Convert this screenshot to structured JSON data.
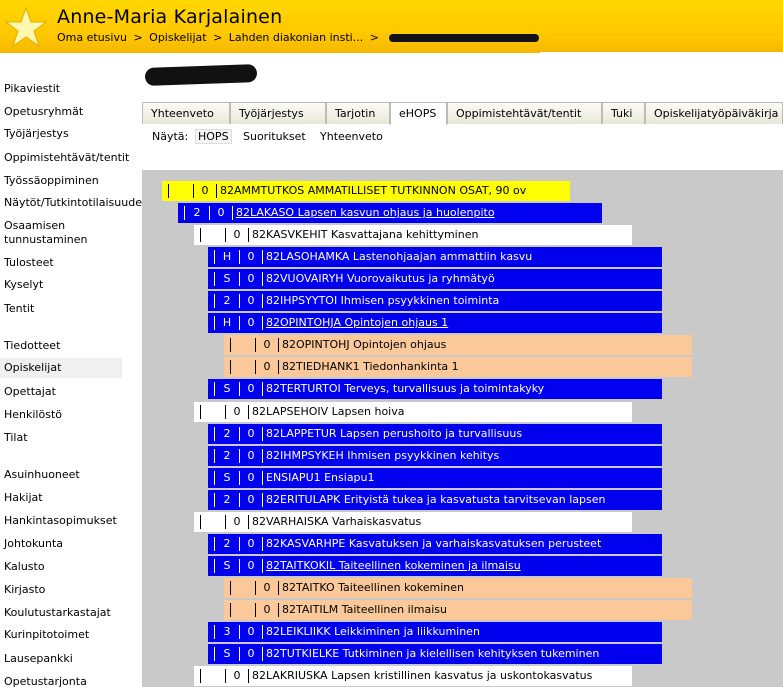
{
  "header": {
    "user_name": "Anne-Maria Karjalainen",
    "breadcrumb": [
      "Oma etusivu",
      "Opiskelijat",
      "Lahden diakonian insti..."
    ],
    "breadcrumb_separator": ">",
    "accent_color": "#ffcc00"
  },
  "sidebar": {
    "items": [
      {
        "label": "Pikaviestit"
      },
      {
        "label": "Opetusryhmät"
      },
      {
        "label": "Työjärjestys"
      },
      {
        "label": "Oppimistehtävät/tentit"
      },
      {
        "label": "Työssäoppiminen"
      },
      {
        "label": "Näytöt/Tutkintotilaisuudet"
      },
      {
        "label": "Osaamisen"
      },
      {
        "label": "tunnustaminen"
      },
      {
        "label": "Tulosteet"
      },
      {
        "label": "Kyselyt"
      },
      {
        "label": "Tentit"
      },
      {
        "label": "Tiedotteet"
      },
      {
        "label": "Opiskelijat"
      },
      {
        "label": "Opettajat"
      },
      {
        "label": "Henkilöstö"
      },
      {
        "label": "Tilat"
      },
      {
        "label": "Asuinhuoneet"
      },
      {
        "label": "Hakijat"
      },
      {
        "label": "Hankintasopimukset"
      },
      {
        "label": "Johtokunta"
      },
      {
        "label": "Kalusto"
      },
      {
        "label": "Kirjasto"
      },
      {
        "label": "Koulutustarkastajat"
      },
      {
        "label": "Kurinpitotoimet"
      },
      {
        "label": "Lausepankki"
      },
      {
        "label": "Opetustarjonta"
      }
    ],
    "active_item": "Opiskelijat"
  },
  "tabs": [
    {
      "label": "Yhteenveto"
    },
    {
      "label": "Työjärjestys"
    },
    {
      "label": "Tarjotin"
    },
    {
      "label": "eHOPS"
    },
    {
      "label": "Oppimistehtävät/tentit"
    },
    {
      "label": "Tuki"
    },
    {
      "label": "Opiskelijatyöpäiväkirja"
    }
  ],
  "active_tab": "eHOPS",
  "subnav": {
    "prefix": "Näytä:",
    "options": [
      {
        "label": "HOPS"
      },
      {
        "label": "Suoritukset"
      },
      {
        "label": "Yhteenveto"
      }
    ],
    "selected": "HOPS"
  },
  "colors": {
    "yellow": "#ffff00",
    "blue": "#0000ee",
    "white": "#ffffff",
    "orange": "#fbc89a",
    "tree_background": "#c9c9c9"
  },
  "tree_rows": [
    {
      "color": "yellow",
      "level": 0,
      "c1": "",
      "c2": "0",
      "text": "82AMMTUTKOS AMMATILLISET TUTKINNON OSAT, 90 ov",
      "link": false
    },
    {
      "color": "blue",
      "level": 1,
      "c1": "2",
      "c2": "0",
      "text": "82LAKASO Lapsen kasvun ohjaus ja huolenpito",
      "link": true
    },
    {
      "color": "white",
      "level": 2,
      "c1": "",
      "c2": "0",
      "text": "82KASVKEHIT Kasvattajana kehittyminen",
      "link": false
    },
    {
      "color": "blue",
      "level": 3,
      "c1": "H",
      "c2": "0",
      "text": "82LASOHAMKA Lastenohjaajan ammattiin kasvu",
      "link": false
    },
    {
      "color": "blue",
      "level": 3,
      "c1": "S",
      "c2": "0",
      "text": "82VUOVAIRYH Vuorovaikutus ja ryhmätyö",
      "link": false
    },
    {
      "color": "blue",
      "level": 3,
      "c1": "2",
      "c2": "0",
      "text": "82IHPSYYTOI Ihmisen psyykkinen toiminta",
      "link": false
    },
    {
      "color": "blue",
      "level": 3,
      "c1": "H",
      "c2": "0",
      "text": "82OPINTOHJA Opintojen ohjaus 1",
      "link": true
    },
    {
      "color": "orange",
      "level": 4,
      "c1": "",
      "c2": "0",
      "text": "82OPINTOHJ Opintojen ohjaus",
      "link": false
    },
    {
      "color": "orange",
      "level": 4,
      "c1": "",
      "c2": "0",
      "text": "82TIEDHANK1 Tiedonhankinta 1",
      "link": false
    },
    {
      "color": "blue",
      "level": 3,
      "c1": "S",
      "c2": "0",
      "text": "82TERTURTOI Terveys, turvallisuus ja toimintakyky",
      "link": false
    },
    {
      "color": "white",
      "level": 2,
      "c1": "",
      "c2": "0",
      "text": "82LAPSEHOIV Lapsen hoiva",
      "link": false
    },
    {
      "color": "blue",
      "level": 3,
      "c1": "2",
      "c2": "0",
      "text": "82LAPPETUR Lapsen perushoito ja turvallisuus",
      "link": false
    },
    {
      "color": "blue",
      "level": 3,
      "c1": "2",
      "c2": "0",
      "text": "82IHMPSYKEH Ihmisen psyykkinen kehitys",
      "link": false
    },
    {
      "color": "blue",
      "level": 3,
      "c1": "S",
      "c2": "0",
      "text": "ENSIAPU1 Ensiapu1",
      "link": false
    },
    {
      "color": "blue",
      "level": 3,
      "c1": "2",
      "c2": "0",
      "text": "82ERITULAPK Erityistä tukea ja kasvatusta tarvitsevan lapsen",
      "link": false
    },
    {
      "color": "white",
      "level": 2,
      "c1": "",
      "c2": "0",
      "text": "82VARHAISKA Varhaiskasvatus",
      "link": false
    },
    {
      "color": "blue",
      "level": 3,
      "c1": "2",
      "c2": "0",
      "text": "82KASVARHPE Kasvatuksen ja varhaiskasvatuksen perusteet",
      "link": false
    },
    {
      "color": "blue",
      "level": 3,
      "c1": "S",
      "c2": "0",
      "text": "82TAITKOKIL Taiteellinen kokeminen ja ilmaisu",
      "link": true
    },
    {
      "color": "orange",
      "level": 4,
      "c1": "",
      "c2": "0",
      "text": "82TAITKO Taiteellinen kokeminen",
      "link": false
    },
    {
      "color": "orange",
      "level": 4,
      "c1": "",
      "c2": "0",
      "text": "82TAITILM Taiteellinen ilmaisu",
      "link": false
    },
    {
      "color": "blue",
      "level": 3,
      "c1": "3",
      "c2": "0",
      "text": "82LEIKLIIKK Leikkiminen ja liikkuminen",
      "link": false
    },
    {
      "color": "blue",
      "level": 3,
      "c1": "S",
      "c2": "0",
      "text": "82TUTKIELKE Tutkiminen ja kielellisen kehityksen tukeminen",
      "link": false
    },
    {
      "color": "white",
      "level": 2,
      "c1": "",
      "c2": "0",
      "text": "82LAKRIUSKA Lapsen kristillinen kasvatus ja uskontokasvatus",
      "link": false
    }
  ]
}
